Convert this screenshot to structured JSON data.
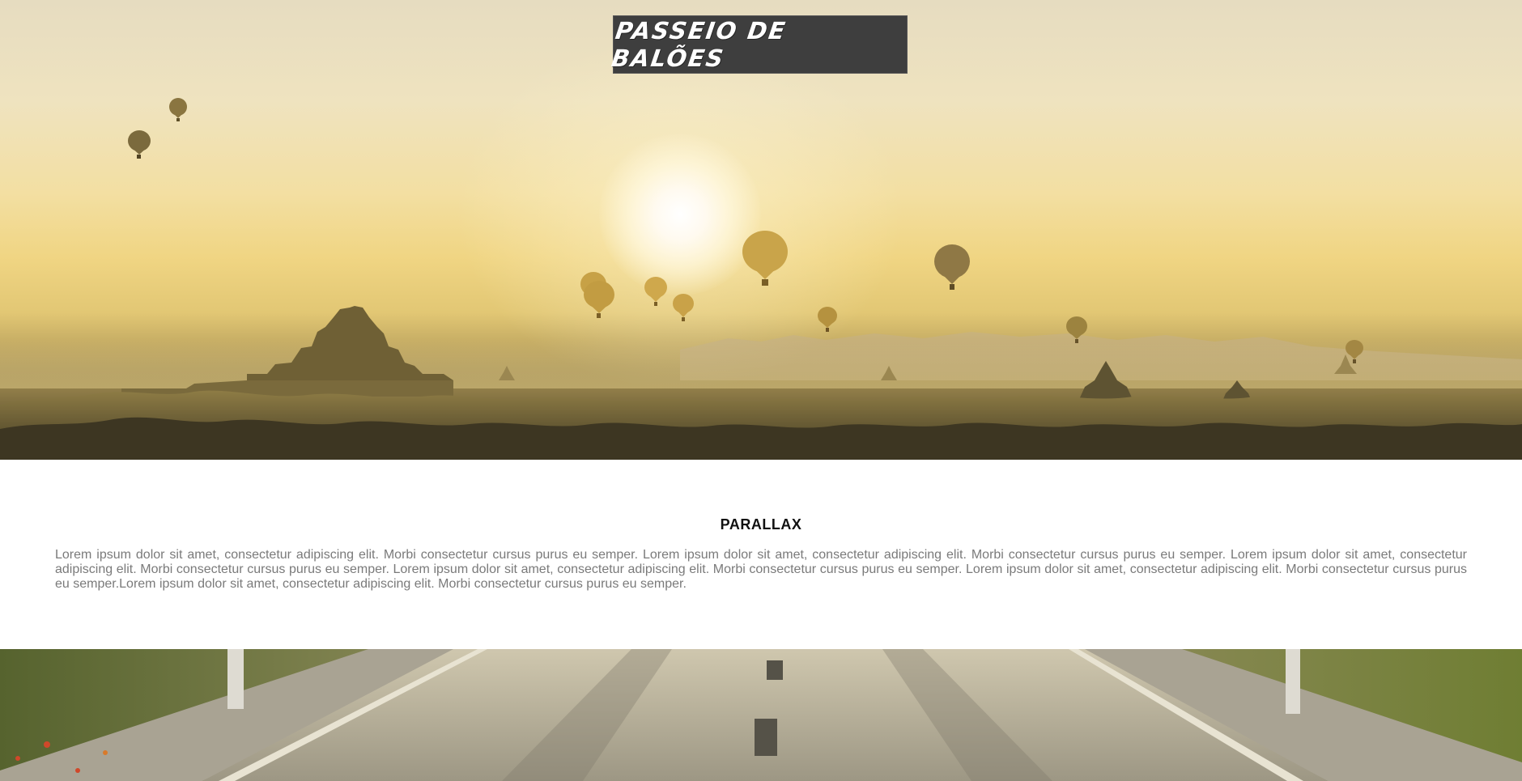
{
  "site": {
    "title": "PASSEIO DE BALÕES"
  },
  "section": {
    "heading": "PARALLAX",
    "body": "Lorem ipsum dolor sit amet, consectetur adipiscing elit. Morbi consectetur cursus purus eu semper. Lorem ipsum dolor sit amet, consectetur adipiscing elit. Morbi consectetur cursus purus eu semper. Lorem ipsum dolor sit amet, consectetur adipiscing elit. Morbi consectetur cursus purus eu semper. Lorem ipsum dolor sit amet, consectetur adipiscing elit. Morbi consectetur cursus purus eu semper. Lorem ipsum dolor sit amet, consectetur adipiscing elit. Morbi consectetur cursus purus eu semper.Lorem ipsum dolor sit amet, consectetur adipiscing elit. Morbi consectetur cursus purus eu semper."
  },
  "images": {
    "hero": "hot-air-balloons-over-temples-at-sunrise",
    "footer": "country-road-with-grass"
  },
  "colors": {
    "title_bg": "#3e3e3e",
    "title_text": "#ffffff",
    "heading_text": "#111111",
    "body_text": "#7a7a7a"
  }
}
